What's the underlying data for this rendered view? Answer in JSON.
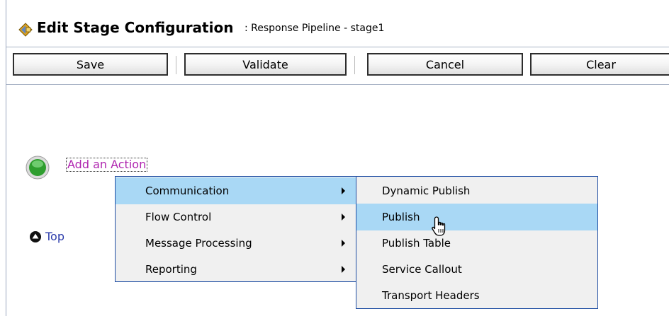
{
  "header": {
    "title": "Edit Stage Configuration",
    "subtitle": ": Response Pipeline - stage1",
    "icon": "stage-config-icon"
  },
  "toolbar": {
    "save_label": "Save",
    "validate_label": "Validate",
    "cancel_label": "Cancel",
    "clear_label": "Clear"
  },
  "content": {
    "add_action_label": "Add an Action",
    "add_action_icon": "green-circle-icon",
    "top_label": "Top",
    "top_icon": "up-arrow-circle-icon"
  },
  "action_menu": {
    "items": [
      {
        "label": "Communication",
        "highlighted": true,
        "has_submenu": true
      },
      {
        "label": "Flow Control",
        "highlighted": false,
        "has_submenu": true
      },
      {
        "label": "Message Processing",
        "highlighted": false,
        "has_submenu": true
      },
      {
        "label": "Reporting",
        "highlighted": false,
        "has_submenu": true
      }
    ]
  },
  "communication_submenu": {
    "items": [
      {
        "label": "Dynamic Publish",
        "highlighted": false
      },
      {
        "label": "Publish",
        "highlighted": true
      },
      {
        "label": "Publish Table",
        "highlighted": false
      },
      {
        "label": "Service Callout",
        "highlighted": false
      },
      {
        "label": "Transport Headers",
        "highlighted": false
      }
    ]
  },
  "colors": {
    "menu_highlight": "#a9d8f5",
    "menu_border": "#1f4ea3",
    "link_purple": "#b026b0",
    "link_blue": "#2c3cab"
  }
}
